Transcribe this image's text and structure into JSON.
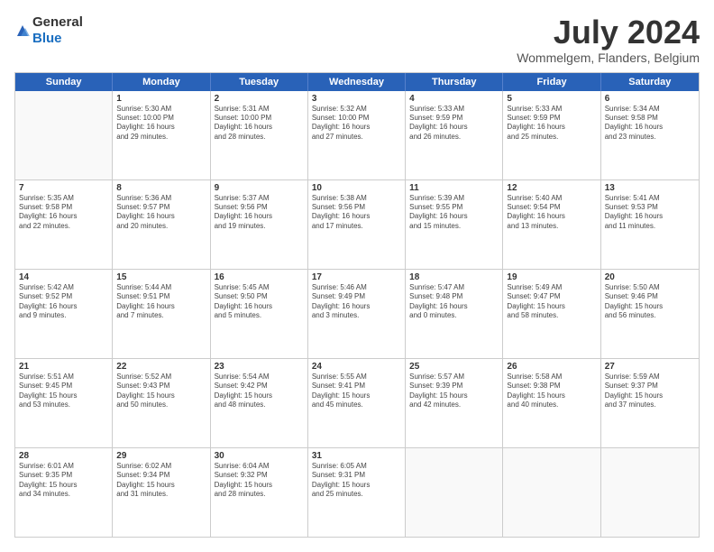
{
  "logo": {
    "general": "General",
    "blue": "Blue"
  },
  "title": "July 2024",
  "location": "Wommelgem, Flanders, Belgium",
  "header_days": [
    "Sunday",
    "Monday",
    "Tuesday",
    "Wednesday",
    "Thursday",
    "Friday",
    "Saturday"
  ],
  "weeks": [
    [
      {
        "day": "",
        "lines": []
      },
      {
        "day": "1",
        "lines": [
          "Sunrise: 5:30 AM",
          "Sunset: 10:00 PM",
          "Daylight: 16 hours",
          "and 29 minutes."
        ]
      },
      {
        "day": "2",
        "lines": [
          "Sunrise: 5:31 AM",
          "Sunset: 10:00 PM",
          "Daylight: 16 hours",
          "and 28 minutes."
        ]
      },
      {
        "day": "3",
        "lines": [
          "Sunrise: 5:32 AM",
          "Sunset: 10:00 PM",
          "Daylight: 16 hours",
          "and 27 minutes."
        ]
      },
      {
        "day": "4",
        "lines": [
          "Sunrise: 5:33 AM",
          "Sunset: 9:59 PM",
          "Daylight: 16 hours",
          "and 26 minutes."
        ]
      },
      {
        "day": "5",
        "lines": [
          "Sunrise: 5:33 AM",
          "Sunset: 9:59 PM",
          "Daylight: 16 hours",
          "and 25 minutes."
        ]
      },
      {
        "day": "6",
        "lines": [
          "Sunrise: 5:34 AM",
          "Sunset: 9:58 PM",
          "Daylight: 16 hours",
          "and 23 minutes."
        ]
      }
    ],
    [
      {
        "day": "7",
        "lines": [
          "Sunrise: 5:35 AM",
          "Sunset: 9:58 PM",
          "Daylight: 16 hours",
          "and 22 minutes."
        ]
      },
      {
        "day": "8",
        "lines": [
          "Sunrise: 5:36 AM",
          "Sunset: 9:57 PM",
          "Daylight: 16 hours",
          "and 20 minutes."
        ]
      },
      {
        "day": "9",
        "lines": [
          "Sunrise: 5:37 AM",
          "Sunset: 9:56 PM",
          "Daylight: 16 hours",
          "and 19 minutes."
        ]
      },
      {
        "day": "10",
        "lines": [
          "Sunrise: 5:38 AM",
          "Sunset: 9:56 PM",
          "Daylight: 16 hours",
          "and 17 minutes."
        ]
      },
      {
        "day": "11",
        "lines": [
          "Sunrise: 5:39 AM",
          "Sunset: 9:55 PM",
          "Daylight: 16 hours",
          "and 15 minutes."
        ]
      },
      {
        "day": "12",
        "lines": [
          "Sunrise: 5:40 AM",
          "Sunset: 9:54 PM",
          "Daylight: 16 hours",
          "and 13 minutes."
        ]
      },
      {
        "day": "13",
        "lines": [
          "Sunrise: 5:41 AM",
          "Sunset: 9:53 PM",
          "Daylight: 16 hours",
          "and 11 minutes."
        ]
      }
    ],
    [
      {
        "day": "14",
        "lines": [
          "Sunrise: 5:42 AM",
          "Sunset: 9:52 PM",
          "Daylight: 16 hours",
          "and 9 minutes."
        ]
      },
      {
        "day": "15",
        "lines": [
          "Sunrise: 5:44 AM",
          "Sunset: 9:51 PM",
          "Daylight: 16 hours",
          "and 7 minutes."
        ]
      },
      {
        "day": "16",
        "lines": [
          "Sunrise: 5:45 AM",
          "Sunset: 9:50 PM",
          "Daylight: 16 hours",
          "and 5 minutes."
        ]
      },
      {
        "day": "17",
        "lines": [
          "Sunrise: 5:46 AM",
          "Sunset: 9:49 PM",
          "Daylight: 16 hours",
          "and 3 minutes."
        ]
      },
      {
        "day": "18",
        "lines": [
          "Sunrise: 5:47 AM",
          "Sunset: 9:48 PM",
          "Daylight: 16 hours",
          "and 0 minutes."
        ]
      },
      {
        "day": "19",
        "lines": [
          "Sunrise: 5:49 AM",
          "Sunset: 9:47 PM",
          "Daylight: 15 hours",
          "and 58 minutes."
        ]
      },
      {
        "day": "20",
        "lines": [
          "Sunrise: 5:50 AM",
          "Sunset: 9:46 PM",
          "Daylight: 15 hours",
          "and 56 minutes."
        ]
      }
    ],
    [
      {
        "day": "21",
        "lines": [
          "Sunrise: 5:51 AM",
          "Sunset: 9:45 PM",
          "Daylight: 15 hours",
          "and 53 minutes."
        ]
      },
      {
        "day": "22",
        "lines": [
          "Sunrise: 5:52 AM",
          "Sunset: 9:43 PM",
          "Daylight: 15 hours",
          "and 50 minutes."
        ]
      },
      {
        "day": "23",
        "lines": [
          "Sunrise: 5:54 AM",
          "Sunset: 9:42 PM",
          "Daylight: 15 hours",
          "and 48 minutes."
        ]
      },
      {
        "day": "24",
        "lines": [
          "Sunrise: 5:55 AM",
          "Sunset: 9:41 PM",
          "Daylight: 15 hours",
          "and 45 minutes."
        ]
      },
      {
        "day": "25",
        "lines": [
          "Sunrise: 5:57 AM",
          "Sunset: 9:39 PM",
          "Daylight: 15 hours",
          "and 42 minutes."
        ]
      },
      {
        "day": "26",
        "lines": [
          "Sunrise: 5:58 AM",
          "Sunset: 9:38 PM",
          "Daylight: 15 hours",
          "and 40 minutes."
        ]
      },
      {
        "day": "27",
        "lines": [
          "Sunrise: 5:59 AM",
          "Sunset: 9:37 PM",
          "Daylight: 15 hours",
          "and 37 minutes."
        ]
      }
    ],
    [
      {
        "day": "28",
        "lines": [
          "Sunrise: 6:01 AM",
          "Sunset: 9:35 PM",
          "Daylight: 15 hours",
          "and 34 minutes."
        ]
      },
      {
        "day": "29",
        "lines": [
          "Sunrise: 6:02 AM",
          "Sunset: 9:34 PM",
          "Daylight: 15 hours",
          "and 31 minutes."
        ]
      },
      {
        "day": "30",
        "lines": [
          "Sunrise: 6:04 AM",
          "Sunset: 9:32 PM",
          "Daylight: 15 hours",
          "and 28 minutes."
        ]
      },
      {
        "day": "31",
        "lines": [
          "Sunrise: 6:05 AM",
          "Sunset: 9:31 PM",
          "Daylight: 15 hours",
          "and 25 minutes."
        ]
      },
      {
        "day": "",
        "lines": []
      },
      {
        "day": "",
        "lines": []
      },
      {
        "day": "",
        "lines": []
      }
    ]
  ]
}
